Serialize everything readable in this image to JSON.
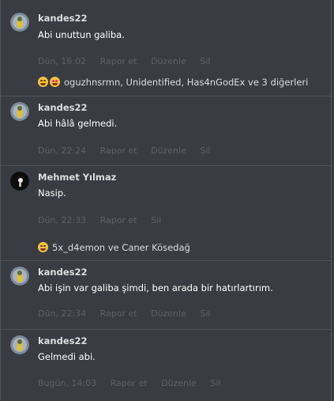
{
  "messages": [
    {
      "author": "kandes22",
      "text": "Abi unuttun galiba.",
      "time": "Dün, 16:02",
      "actions": [
        "Rapor et",
        "Düzenle",
        "Sil"
      ],
      "reactions": "oguzhnsrmn, Unidentified, Has4nGodEx ve 3 diğerleri",
      "reaction_icons": [
        "rofl-icon",
        "heart-eyes-icon"
      ],
      "avatar": "kandes22-avatar"
    },
    {
      "author": "kandes22",
      "text": "Abi hâlâ gelmedi.",
      "time": "Dün, 22:24",
      "actions": [
        "Rapor et",
        "Düzenle",
        "Sil"
      ],
      "avatar": "kandes22-avatar"
    },
    {
      "author": "Mehmet Yılmaz",
      "text": "Nasip.",
      "time": "Dün, 22:33",
      "actions": [
        "Rapor et",
        "Sil"
      ],
      "reactions": "5x_d4emon ve Caner Kösedağ",
      "reaction_icons": [
        "rofl-icon"
      ],
      "avatar": "mehmet-avatar"
    },
    {
      "author": "kandes22",
      "text": "Abi işin var galiba şimdi, ben arada bir hatırlartırım.",
      "time": "Dün, 22:34",
      "actions": [
        "Rapor et",
        "Düzenle",
        "Sil"
      ],
      "avatar": "kandes22-avatar"
    },
    {
      "author": "kandes22",
      "text": "Gelmedi abi.",
      "time": "Bugün, 14:03",
      "actions": [
        "Rapor et",
        "Düzenle",
        "Sil"
      ],
      "avatar": "kandes22-avatar"
    }
  ]
}
